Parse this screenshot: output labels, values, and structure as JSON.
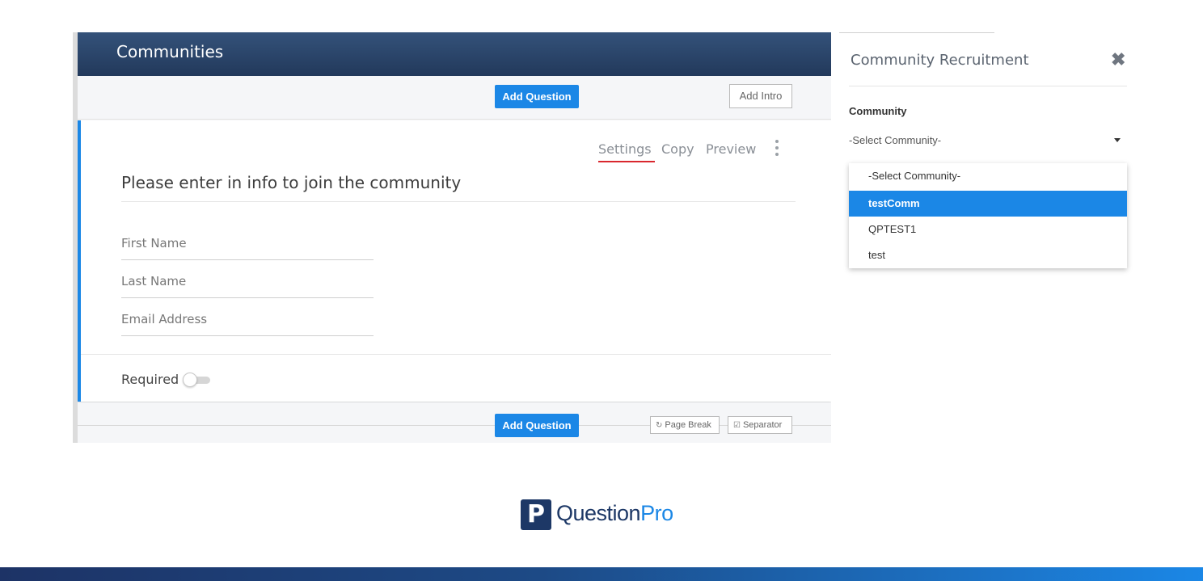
{
  "app": {
    "title": "Communities",
    "toolbar_top": {
      "add_question": "Add Question",
      "add_intro": "Add Intro"
    },
    "card": {
      "actions": {
        "settings": "Settings",
        "copy": "Copy",
        "preview": "Preview"
      },
      "question_text": "Please enter in info to join the community",
      "fields": [
        {
          "placeholder": "First Name"
        },
        {
          "placeholder": "Last Name"
        },
        {
          "placeholder": "Email Address"
        }
      ],
      "required_label": "Required",
      "required_on": false
    },
    "toolbar_bottom": {
      "add_question": "Add Question",
      "page_break": "Page Break",
      "separator": "Separator"
    }
  },
  "side_panel": {
    "title": "Community Recruitment",
    "field_label": "Community",
    "selected_value": "-Select Community-",
    "options": [
      "-Select Community-",
      "testComm",
      "QPTEST1",
      "test"
    ],
    "highlighted_option": "testComm"
  },
  "brand": {
    "part1": "Question",
    "part2": "Pro",
    "mark": "P"
  },
  "colors": {
    "header": "#22395b",
    "accent": "#1b87e6",
    "brand_navy": "#1d3866",
    "settings_underline": "#d9272e"
  }
}
